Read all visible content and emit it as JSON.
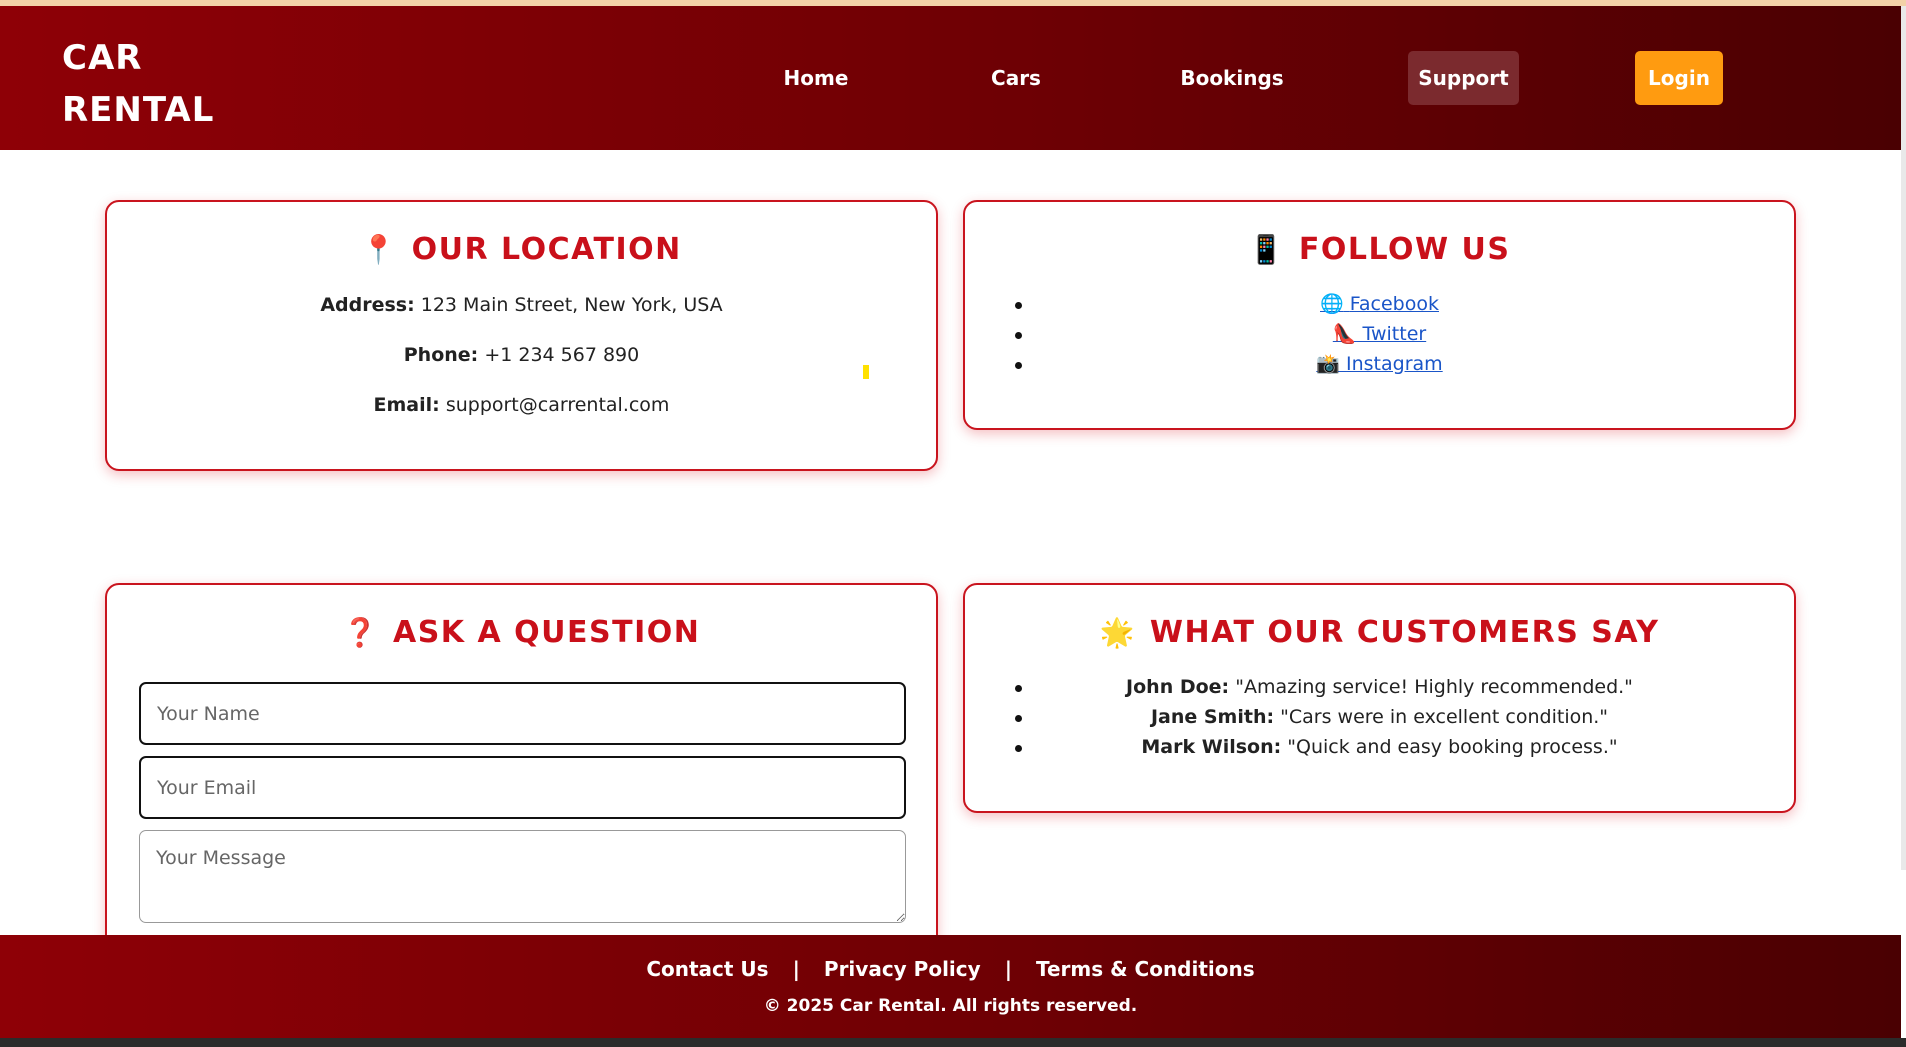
{
  "header": {
    "logo_line1": "CAR",
    "logo_line2": "RENTAL",
    "nav": {
      "home": "Home",
      "cars": "Cars",
      "bookings": "Bookings",
      "support": "Support",
      "login": "Login"
    },
    "active": "Support"
  },
  "location": {
    "icon": "📍",
    "title": "OUR LOCATION",
    "address_label": "Address:",
    "address": "123 Main Street, New York, USA",
    "phone_label": "Phone:",
    "phone": "+1 234 567 890",
    "email_label": "Email:",
    "email": "support@carrental.com"
  },
  "follow": {
    "icon": "📱",
    "title": "FOLLOW US",
    "links": [
      {
        "icon": "🌐",
        "label": "Facebook"
      },
      {
        "icon": "👠",
        "label": "Twitter"
      },
      {
        "icon": "📸",
        "label": "Instagram"
      }
    ]
  },
  "ask": {
    "icon": "❓",
    "title": "ASK A QUESTION",
    "name_placeholder": "Your Name",
    "email_placeholder": "Your Email",
    "message_placeholder": "Your Message"
  },
  "reviews": {
    "icon": "🌟",
    "title": "WHAT OUR CUSTOMERS SAY",
    "items": [
      {
        "name": "John Doe:",
        "quote": "\"Amazing service! Highly recommended.\""
      },
      {
        "name": "Jane Smith:",
        "quote": "\"Cars were in excellent condition.\""
      },
      {
        "name": "Mark Wilson:",
        "quote": "\"Quick and easy booking process.\""
      }
    ]
  },
  "footer": {
    "contact": "Contact Us",
    "privacy": "Privacy Policy",
    "terms": "Terms & Conditions",
    "separator": "|",
    "copyright": "© 2025 Car Rental. All rights reserved."
  },
  "colors": {
    "header_start": "#8e0006",
    "header_end": "#4a0002",
    "accent_red": "#c9101a",
    "login_orange": "#ff9b10",
    "link_blue": "#1a55c8"
  }
}
